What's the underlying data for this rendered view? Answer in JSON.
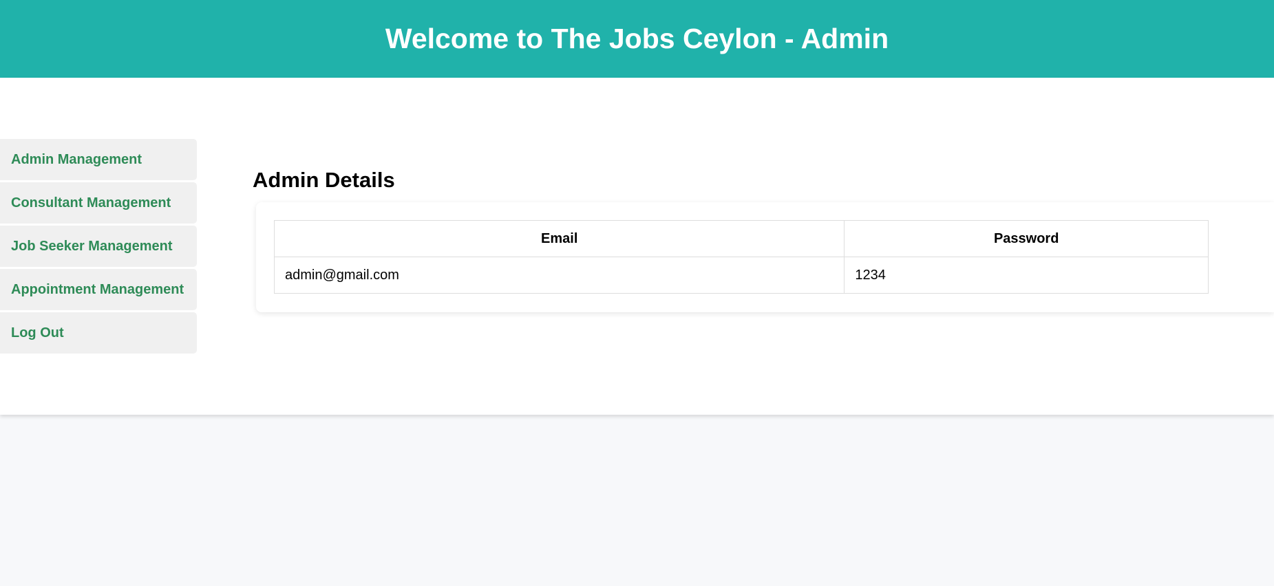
{
  "header": {
    "title": "Welcome to The Jobs Ceylon - Admin"
  },
  "sidebar": {
    "items": [
      {
        "label": "Admin Management"
      },
      {
        "label": "Consultant Management"
      },
      {
        "label": "Job Seeker Management"
      },
      {
        "label": "Appointment Management"
      },
      {
        "label": "Log Out"
      }
    ]
  },
  "main": {
    "section_title": "Admin Details",
    "table": {
      "columns": [
        "Email",
        "Password"
      ],
      "rows": [
        [
          "admin@gmail.com",
          "1234"
        ]
      ]
    }
  },
  "colors": {
    "header_bg": "#20b2aa",
    "sidebar_text": "#2e8b57",
    "sidebar_bg": "#f0f0f0",
    "page_bg": "#f7f8fa"
  }
}
